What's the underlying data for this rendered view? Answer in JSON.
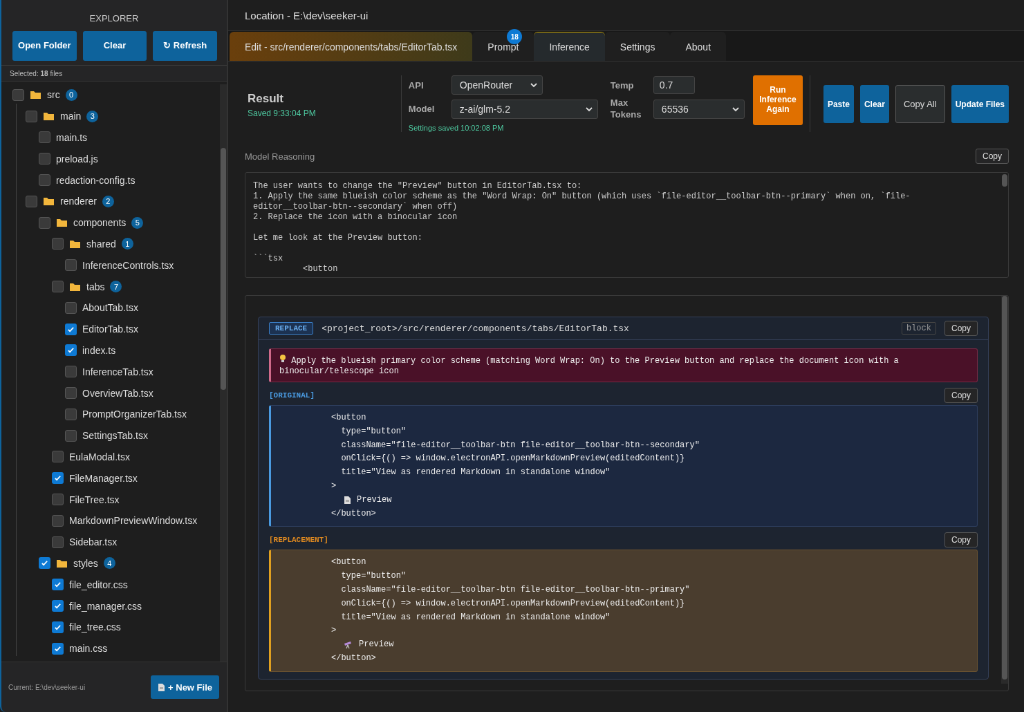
{
  "sidebar": {
    "title": "EXPLORER",
    "buttons": [
      {
        "label": "Open Folder"
      },
      {
        "label": "Clear"
      },
      {
        "label": "↻ Refresh"
      }
    ],
    "selected_count": "Selected: **18** files",
    "tree": [
      {
        "kind": "folder",
        "name": "src",
        "count": "0",
        "checked": false,
        "children": [
          {
            "kind": "folder",
            "name": "main",
            "count": "3",
            "checked": false,
            "children": [
              {
                "kind": "file",
                "name": "main.ts",
                "checked": false
              },
              {
                "kind": "file",
                "name": "preload.js",
                "checked": false
              },
              {
                "kind": "file",
                "name": "redaction-config.ts",
                "checked": false
              }
            ]
          },
          {
            "kind": "folder",
            "name": "renderer",
            "count": "2",
            "checked": false,
            "children": [
              {
                "kind": "folder",
                "name": "components",
                "count": "5",
                "checked": false,
                "children": [
                  {
                    "kind": "folder",
                    "name": "shared",
                    "count": "1",
                    "checked": false,
                    "children": [
                      {
                        "kind": "file",
                        "name": "InferenceControls.tsx",
                        "checked": false
                      }
                    ]
                  },
                  {
                    "kind": "folder",
                    "name": "tabs",
                    "count": "7",
                    "checked": false,
                    "children": [
                      {
                        "kind": "file",
                        "name": "AboutTab.tsx",
                        "checked": false
                      },
                      {
                        "kind": "file",
                        "name": "EditorTab.tsx",
                        "checked": true
                      },
                      {
                        "kind": "file",
                        "name": "index.ts",
                        "checked": true
                      },
                      {
                        "kind": "file",
                        "name": "InferenceTab.tsx",
                        "checked": false
                      },
                      {
                        "kind": "file",
                        "name": "OverviewTab.tsx",
                        "checked": false
                      },
                      {
                        "kind": "file",
                        "name": "PromptOrganizerTab.tsx",
                        "checked": false
                      },
                      {
                        "kind": "file",
                        "name": "SettingsTab.tsx",
                        "checked": false
                      }
                    ]
                  },
                  {
                    "kind": "file",
                    "name": "EulaModal.tsx",
                    "checked": false
                  },
                  {
                    "kind": "file",
                    "name": "FileManager.tsx",
                    "checked": true
                  },
                  {
                    "kind": "file",
                    "name": "FileTree.tsx",
                    "checked": false
                  },
                  {
                    "kind": "file",
                    "name": "MarkdownPreviewWindow.tsx",
                    "checked": false
                  },
                  {
                    "kind": "file",
                    "name": "Sidebar.tsx",
                    "checked": false
                  }
                ]
              },
              {
                "kind": "folder",
                "name": "styles",
                "count": "4",
                "checked": true,
                "children": [
                  {
                    "kind": "file",
                    "name": "file_editor.css",
                    "checked": true
                  },
                  {
                    "kind": "file",
                    "name": "file_manager.css",
                    "checked": true
                  },
                  {
                    "kind": "file",
                    "name": "file_tree.css",
                    "checked": true
                  },
                  {
                    "kind": "file",
                    "name": "main.css",
                    "checked": true
                  }
                ]
              }
            ]
          }
        ]
      }
    ],
    "current": "Current: E:\\dev\\seeker-ui",
    "new_file": "+ New File"
  },
  "location": "Location - E:\\dev\\seeker-ui",
  "tabs": [
    {
      "kind": "edit",
      "label": "Edit - src/renderer/components/tabs/EditorTab.tsx",
      "selected": false
    },
    {
      "kind": "normal",
      "label": "Prompt",
      "badge": "18",
      "selected": false
    },
    {
      "kind": "normal",
      "label": "Inference",
      "selected": true
    },
    {
      "kind": "normal",
      "label": "Settings",
      "selected": false
    },
    {
      "kind": "normal",
      "label": "About",
      "selected": false
    }
  ],
  "result": {
    "title": "Result",
    "saved": "Saved 9:33:04 PM"
  },
  "settings": {
    "api_label": "API",
    "api": "OpenRouter",
    "model_label": "Model",
    "model": "z-ai/glm-5.2",
    "saved": "Settings saved 10:02:08 PM",
    "temp_label": "Temp",
    "temp": "0.7",
    "max_tokens_label": "Max Tokens",
    "max_tokens": "65536"
  },
  "run_button": "Run Inference Again",
  "actions": [
    {
      "label": "Paste",
      "kind": "primary"
    },
    {
      "label": "Clear",
      "kind": "primary"
    },
    {
      "label": "Copy All",
      "kind": "secondary"
    },
    {
      "label": "Update Files",
      "kind": "primary"
    }
  ],
  "reasoning": {
    "label": "Model Reasoning",
    "copy": "Copy",
    "text": "The user wants to change the \"Preview\" button in EditorTab.tsx to:\n1. Apply the same blueish color scheme as the \"Word Wrap: On\" button (which uses `file-editor__toolbar-btn--primary` when on, `file-\neditor__toolbar-btn--secondary` when off)\n2. Replace the icon with a binocular icon\n\nLet me look at the Preview button:\n\n```tsx\n          <button"
  },
  "replace": {
    "tag": "REPLACE",
    "path": "<project_root>/src/renderer/components/tabs/EditorTab.tsx",
    "mode": "block",
    "copy": "Copy",
    "note": "Apply the blueish primary color scheme (matching Word Wrap: On) to the Preview button and replace the document icon with a binocular/telescope icon",
    "blocks": [
      {
        "kind": "original",
        "label": "[ORIGINAL]",
        "copy": "Copy",
        "lines": [
          {
            "text": "          <button"
          },
          {
            "text": "            type=\"button\""
          },
          {
            "text": "            className=\"file-editor__toolbar-btn file-editor__toolbar-btn--secondary\""
          },
          {
            "text": "            onClick={() => window.electronAPI.openMarkdownPreview(editedContent)}"
          },
          {
            "text": "            title=\"View as rendered Markdown in standalone window\""
          },
          {
            "text": "          >"
          },
          {
            "text": "Preview",
            "kind": "document"
          },
          {
            "text": "          </button>"
          }
        ]
      },
      {
        "kind": "replacement",
        "label": "[REPLACEMENT]",
        "copy": "Copy",
        "lines": [
          {
            "text": "          <button"
          },
          {
            "text": "            type=\"button\""
          },
          {
            "text": "            className=\"file-editor__toolbar-btn file-editor__toolbar-btn--primary\""
          },
          {
            "text": "            onClick={() => window.electronAPI.openMarkdownPreview(editedContent)}"
          },
          {
            "text": "            title=\"View as rendered Markdown in standalone window\""
          },
          {
            "text": "          >"
          },
          {
            "text": "Preview",
            "kind": "telescope"
          },
          {
            "text": "          </button>"
          }
        ]
      }
    ]
  }
}
